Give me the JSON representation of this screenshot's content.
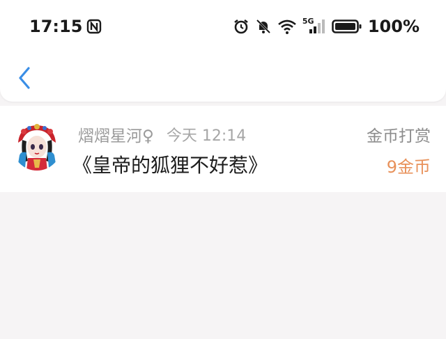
{
  "status_bar": {
    "time": "17:15",
    "battery_percent": "100%",
    "network": "5G"
  },
  "record": {
    "nickname": "熠熠星河♀",
    "timestamp": "今天 12:14",
    "book_title": "《皇帝的狐狸不好惹》",
    "type_label": "金币打赏",
    "amount": "9金币"
  },
  "colors": {
    "accent_back": "#3a8ee6",
    "amount": "#e8915a",
    "background": "#f6f4f5"
  }
}
